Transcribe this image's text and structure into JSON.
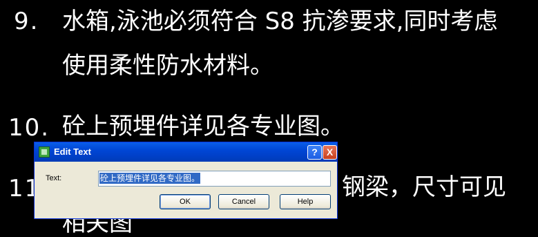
{
  "cad": {
    "item9_number": "9.",
    "item9_line1": "水箱,泳池必须符合 S8  抗渗要求,同时考虑",
    "item9_line2": "使用柔性防水材料。",
    "item10_number": "10.",
    "item10_text": "砼上预埋件详见各专业图。",
    "item11_number": "11",
    "item11_partial": "钢梁，尺寸可见",
    "item11_line2_partial": "相关图"
  },
  "dialog": {
    "title": "Edit Text",
    "help_title_button": "?",
    "close_title_button": "X",
    "text_label": "Text:",
    "text_value": "砼上预埋件详见各专业图。",
    "ok_label": "OK",
    "cancel_label": "Cancel",
    "help_label": "Help"
  }
}
